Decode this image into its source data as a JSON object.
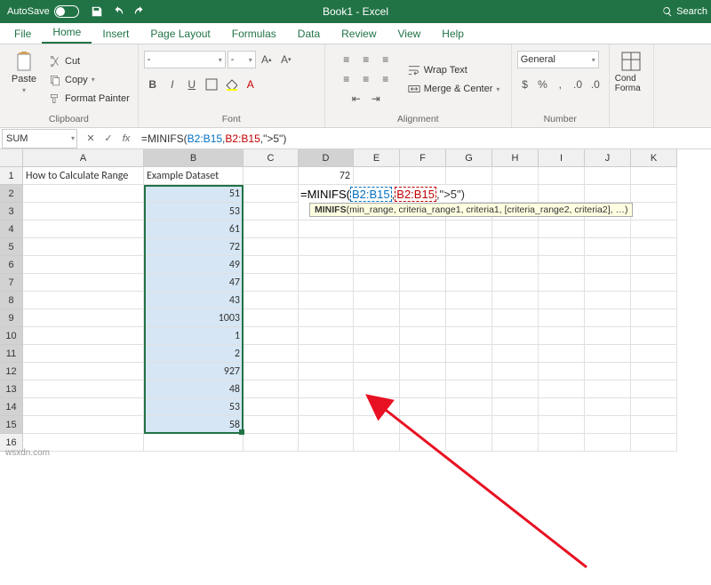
{
  "titlebar": {
    "autosave_label": "AutoSave",
    "autosave_state": "Off",
    "title": "Book1 - Excel",
    "search_label": "Search"
  },
  "tabs": [
    "File",
    "Home",
    "Insert",
    "Page Layout",
    "Formulas",
    "Data",
    "Review",
    "View",
    "Help"
  ],
  "active_tab": "Home",
  "ribbon": {
    "clipboard": {
      "label": "Clipboard",
      "paste": "Paste",
      "cut": "Cut",
      "copy": "Copy",
      "painter": "Format Painter"
    },
    "font": {
      "label": "Font",
      "name": "-",
      "size": "-",
      "b": "B",
      "i": "I",
      "u": "U"
    },
    "alignment": {
      "label": "Alignment",
      "wrap": "Wrap Text",
      "merge": "Merge & Center"
    },
    "number": {
      "label": "Number",
      "format": "General"
    },
    "conditional": "Cond Forma"
  },
  "formula_bar": {
    "name_box": "SUM",
    "fx": "fx",
    "formula_prefix": "=MINIFS(",
    "ref1": "B2:B15",
    "ref2": "B2:B15",
    "str": "\">5\"",
    "suffix": ")"
  },
  "cols": [
    "A",
    "B",
    "C",
    "D",
    "E",
    "F",
    "G",
    "H",
    "I",
    "J",
    "K"
  ],
  "grid": {
    "A1": "How to Calculate Range",
    "B1": "Example Dataset",
    "D1": "72",
    "B": [
      51,
      53,
      61,
      72,
      49,
      47,
      43,
      1003,
      1,
      2,
      927,
      48,
      53,
      58
    ]
  },
  "cell_edit": {
    "prefix": "=MINIFS",
    "paren": "(",
    "r1": "B2:B15",
    "comma": ",",
    "r2": "B2:B15",
    "str": ",\">5\")"
  },
  "tooltip": {
    "fn": "MINIFS",
    "sig": "(min_range, criteria_range1, criteria1, [criteria_range2, criteria2], …)"
  },
  "watermark": "wsxdn.com",
  "chart_data": null
}
